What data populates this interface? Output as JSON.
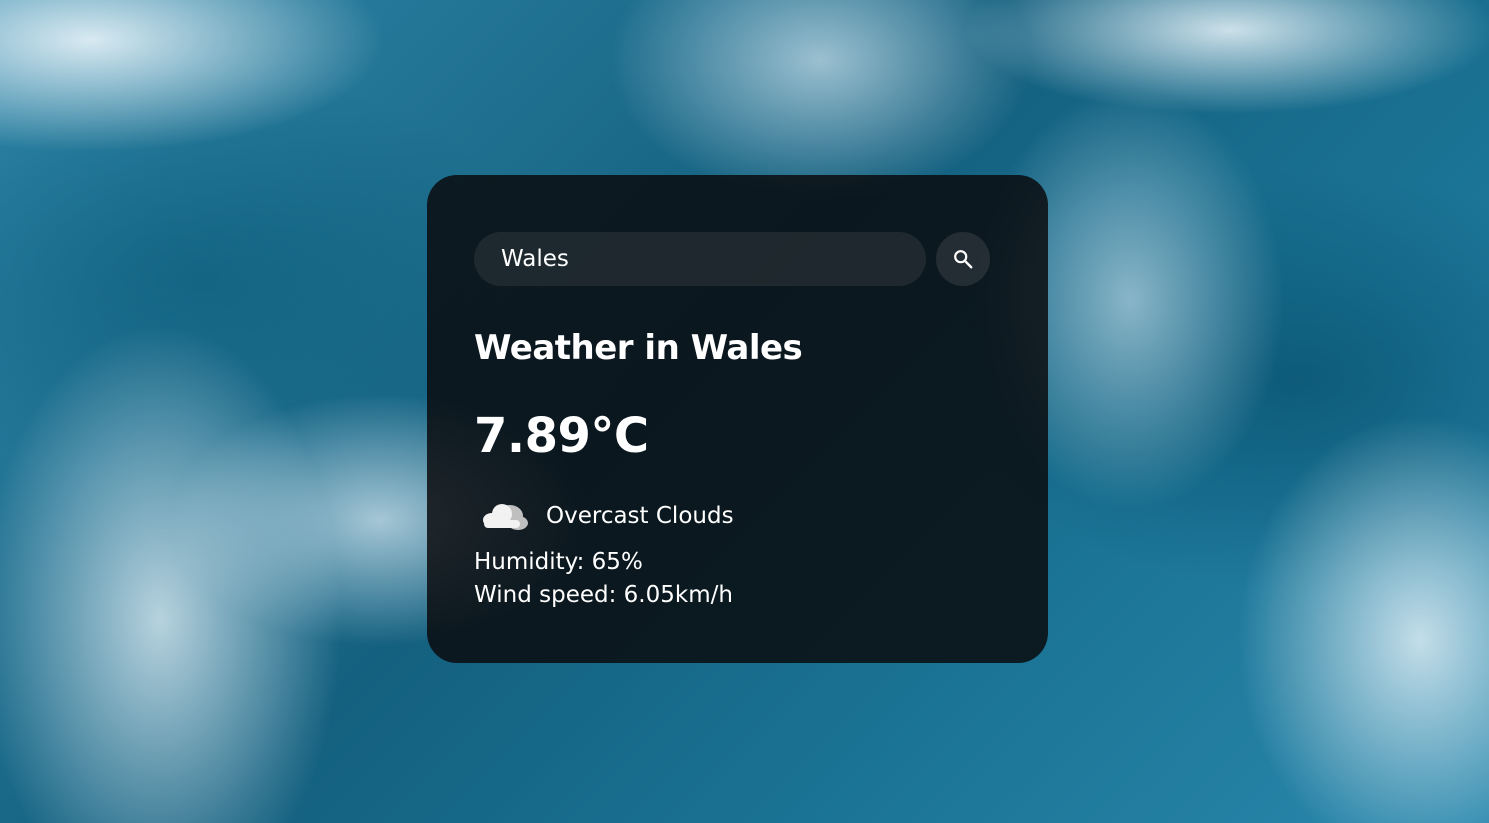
{
  "search": {
    "value": "Wales",
    "button_icon": "search-icon"
  },
  "weather": {
    "title": "Weather in Wales",
    "temperature": "7.89°C",
    "icon": "cloud-icon",
    "description": "Overcast Clouds",
    "humidity": "Humidity: 65%",
    "wind": "Wind speed: 6.05km/h"
  },
  "colors": {
    "card_background": "#0a0a0c",
    "text": "#ffffff",
    "background_sea": "#1d6c8f"
  }
}
